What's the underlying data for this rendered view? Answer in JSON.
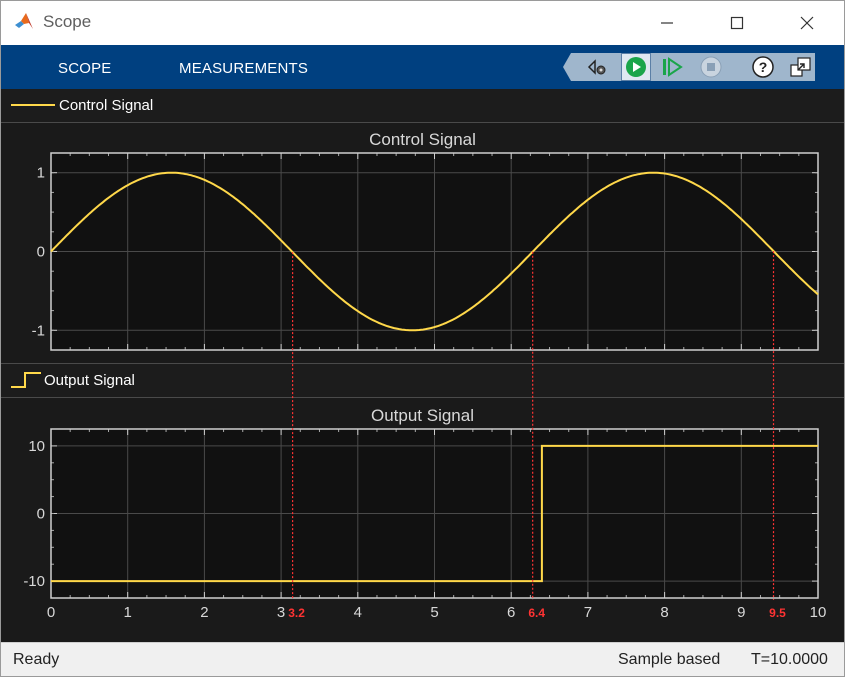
{
  "window": {
    "title": "Scope"
  },
  "toolstrip": {
    "tabs": [
      {
        "label": "SCOPE"
      },
      {
        "label": "MEASUREMENTS"
      }
    ]
  },
  "toolbar": {
    "icons": [
      "settings-icon",
      "run-icon",
      "step-forward-icon",
      "stop-icon",
      "help-icon",
      "undock-icon"
    ]
  },
  "legends": [
    {
      "label": "Control Signal",
      "icon": "line-legend-icon"
    },
    {
      "label": "Output Signal",
      "icon": "step-legend-icon"
    }
  ],
  "colors": {
    "signal": "#ffd84a",
    "cursor": "#ff3333",
    "grid": "#4a4a4a",
    "plot_bg": "#111111",
    "toolstrip": "#004080"
  },
  "cursors": [
    {
      "label": "3.2",
      "x": 3.15
    },
    {
      "label": "6.4",
      "x": 6.28
    },
    {
      "label": "9.5",
      "x": 9.42
    }
  ],
  "status": {
    "left": "Ready",
    "mode": "Sample based",
    "time": "T=10.0000"
  },
  "chart_data": [
    {
      "type": "line",
      "title": "Control Signal",
      "xlim": [
        0,
        10
      ],
      "ylim": [
        -1.25,
        1.25
      ],
      "yticks": [
        1,
        0,
        -1
      ],
      "ytick_labels": [
        "1",
        "0",
        "-1"
      ],
      "grid": true,
      "series": [
        {
          "name": "Control Signal",
          "function": "sin(t)",
          "x_start": 0,
          "x_end": 10
        }
      ]
    },
    {
      "type": "line",
      "title": "Output Signal",
      "xlim": [
        0,
        10
      ],
      "ylim": [
        -12.5,
        12.5
      ],
      "yticks": [
        10,
        0,
        -10
      ],
      "ytick_labels": [
        "10",
        "0",
        "-10"
      ],
      "xticks": [
        0,
        1,
        2,
        3,
        4,
        5,
        6,
        7,
        8,
        9,
        10
      ],
      "xtick_labels": [
        "0",
        "1",
        "2",
        "3",
        "4",
        "5",
        "6",
        "7",
        "8",
        "9",
        "10"
      ],
      "grid": true,
      "series": [
        {
          "name": "Output Signal",
          "x": [
            0,
            6.4,
            6.4,
            10
          ],
          "y": [
            -10,
            -10,
            10,
            10
          ]
        }
      ]
    }
  ]
}
